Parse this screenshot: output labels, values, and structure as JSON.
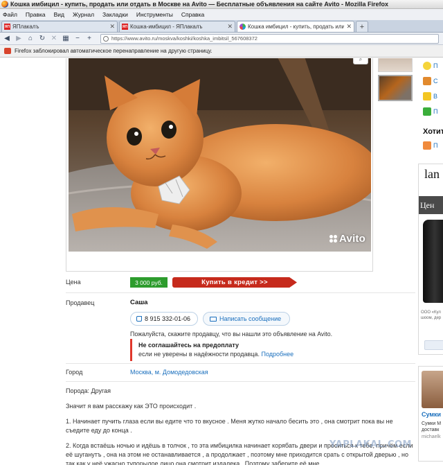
{
  "window": {
    "title": "Кошка имбицил - купить, продать или отдать в Москве на Avito — Бесплатные объявления на сайте Avito - Mozilla Firefox"
  },
  "menu": [
    "Файл",
    "Правка",
    "Вид",
    "Журнал",
    "Закладки",
    "Инструменты",
    "Справка"
  ],
  "tabs": [
    {
      "label": "ЯПлакалъ",
      "favicon": "yaplakal-icon",
      "active": false
    },
    {
      "label": "Кошка-имбицил - ЯПлакалъ",
      "favicon": "yaplakal-icon",
      "active": false
    },
    {
      "label": "Кошка имбицил - купить, продать или ...",
      "favicon": "avito-icon",
      "active": true
    }
  ],
  "nav": {
    "url": "https://www.avito.ru/moskva/koshki/koshka_imbitsil_567608372"
  },
  "notification": {
    "text": "Firefox заблокировал автоматическое перенаправление на другую страницу."
  },
  "listing": {
    "photo_watermark": "Avito",
    "price_label": "Цена",
    "price": "3 000 руб.",
    "credit_button": "Купить в кредит >>",
    "seller_label": "Продавец",
    "seller_name": "Саша",
    "phone": "8 915 332-01-06",
    "message_button": "Написать сообщение",
    "hint": "Пожалуйста, скажите продавцу, что вы нашли это объявление на Avito.",
    "warning_title": "Не соглашайтесь на предоплату",
    "warning_text": "если не уверены в надёжности продавца.",
    "warning_link": "Подробнее",
    "city_label": "Город",
    "city": "Москва, м. Домодедовская",
    "description": [
      "Порода: Другая",
      "Значит я вам расскажу как ЭТО происходит .",
      "1. Начинает пучить глаза если вы едите что то вкусное . Меня жутко начало бесить это , она смотрит пока вы не съедите еду до конца .",
      "2. Когда встаёшь ночью и идёшь в толчок , то эта имбицилка начинает корябать двери и проситься к тебе, причём если её шуганутъ , она на этом не останавливается , а продолжает , поэтому мне приходится срать с открытой дверью , но так как у неё ужасно тупорылое лицо она смотрит издалека . Поэтому заберите её мне"
    ]
  },
  "sidebar": {
    "links": [
      "П",
      "С",
      "В",
      "П"
    ],
    "heading": "Хотит",
    "link2": "П",
    "ad_brand": "lan",
    "ad_band": "Цен",
    "ad_small": "ООО «Кул шоом, дер",
    "bags_title": "Сумки",
    "bags_text": "Сумки М доставк",
    "bags_url": "michaelk"
  },
  "site_watermark": "YAPLAKAL.COM"
}
